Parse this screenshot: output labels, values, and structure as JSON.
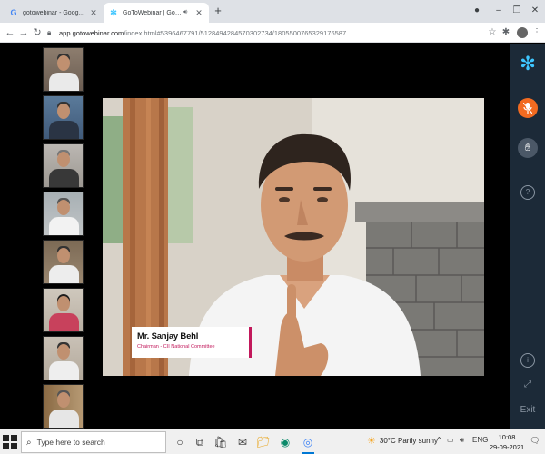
{
  "browser": {
    "tabs": [
      {
        "title": "gotowebinar - Google Search",
        "favicon": "google-icon"
      },
      {
        "title": "GoToWebinar | GoToWebinar",
        "favicon": "gotowebinar-icon"
      }
    ],
    "url_host": "app.gotowebinar.com",
    "url_path": "/index.html#5396467791/5128494284570302734/1805500765329176587"
  },
  "webinar": {
    "presenter": {
      "name": "Mr. Sanjay Behl",
      "title": "Chairman - CII National Committee"
    },
    "participant_count_shown": 8,
    "rail": {
      "exit_label": "Exit",
      "help_label": "?",
      "info_label": "i"
    }
  },
  "taskbar": {
    "search_placeholder": "Type here to search",
    "weather_temp": "30°C",
    "weather_text": "Partly sunny",
    "language": "ENG",
    "time": "10:08",
    "date": "29-09-2021"
  },
  "colors": {
    "rail_bg": "#1c2a38",
    "gotowebinar_blue": "#3ec6ff",
    "mic_orange": "#f26b21",
    "name_accent": "#c2185b"
  }
}
